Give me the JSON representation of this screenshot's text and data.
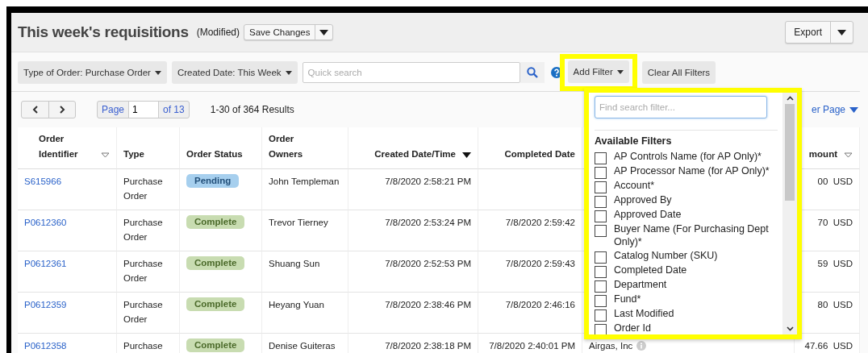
{
  "header": {
    "title": "This week's requisitions",
    "modified": "(Modified)",
    "save_button": "Save Changes",
    "export_button": "Export"
  },
  "filters": {
    "chips": [
      "Type of Order: Purchase Order",
      "Created Date: This Week"
    ],
    "search": {
      "placeholder": "Quick search"
    },
    "add_filter": "Add Filter",
    "clear_filters": "Clear All Filters"
  },
  "pagination": {
    "page_label": "Page",
    "page_value": "1",
    "of_pages": "of 13",
    "results": "1-30 of 364 Results",
    "per_page": "er Page"
  },
  "table": {
    "columns": [
      {
        "label": "Order Identifier",
        "sort_active": false
      },
      {
        "label": "Type"
      },
      {
        "label": "Order Status"
      },
      {
        "label": "Order Owners"
      },
      {
        "label": "Created Date/Time",
        "sort_active": true
      },
      {
        "label": "Completed Date"
      },
      {},
      {
        "label": "mount",
        "sort_active": false
      }
    ],
    "rows": [
      {
        "id": "S615966",
        "type": "Purchase Order",
        "status": {
          "label": "Pending",
          "kind": "pending"
        },
        "owner": "John Templeman",
        "created": "7/8/2020 2:58:21 PM",
        "amount": "00  USD"
      },
      {
        "id": "P0612360",
        "type": "Purchase Order",
        "status": {
          "label": "Complete",
          "kind": "complete"
        },
        "owner": "Trevor Tierney",
        "created": "7/8/2020 2:53:24 PM",
        "completed": "7/8/2020 2:59:42",
        "amount": "70  USD"
      },
      {
        "id": "P0612361",
        "type": "Purchase Order",
        "status": {
          "label": "Complete",
          "kind": "complete"
        },
        "owner": "Shuang Sun",
        "created": "7/8/2020 2:52:53 PM",
        "completed": "7/8/2020 2:59:43",
        "amount": "59  USD"
      },
      {
        "id": "P0612359",
        "type": "Purchase Order",
        "status": {
          "label": "Complete",
          "kind": "complete"
        },
        "owner": "Heyang Yuan",
        "created": "7/8/2020 2:38:46 PM",
        "completed": "7/8/2020 2:46:16",
        "amount": "80  USD"
      },
      {
        "id": "P0612358",
        "type": "Purchase",
        "status": {
          "label": "Complete",
          "kind": "complete"
        },
        "owner": "Denise Guiteras",
        "created": "7/8/2020 2:38:18 PM",
        "completed": "7/8/2020 2:40:01 PM",
        "supplier": "Airgas, Inc",
        "amount": "47.66  USD"
      }
    ]
  },
  "filter_menu": {
    "search": {
      "placeholder": "Find search filter..."
    },
    "heading": "Available Filters",
    "items": [
      {
        "label": "AP Controls Name (for AP Only)*",
        "checked": false
      },
      {
        "label": "AP Processor Name (for AP Only)*",
        "checked": false
      },
      {
        "label": "Account*",
        "checked": false
      },
      {
        "label": "Approved By",
        "checked": false
      },
      {
        "label": "Approved Date",
        "checked": false
      },
      {
        "label": "Buyer Name (For Purchasing Dept Only)*",
        "checked": false
      },
      {
        "label": "Catalog Number (SKU)",
        "checked": false
      },
      {
        "label": "Completed Date",
        "checked": false
      },
      {
        "label": "Department",
        "checked": false
      },
      {
        "label": "Fund*",
        "checked": false
      },
      {
        "label": "Last Modified",
        "checked": false
      },
      {
        "label": "Order Id",
        "checked": false
      }
    ]
  }
}
